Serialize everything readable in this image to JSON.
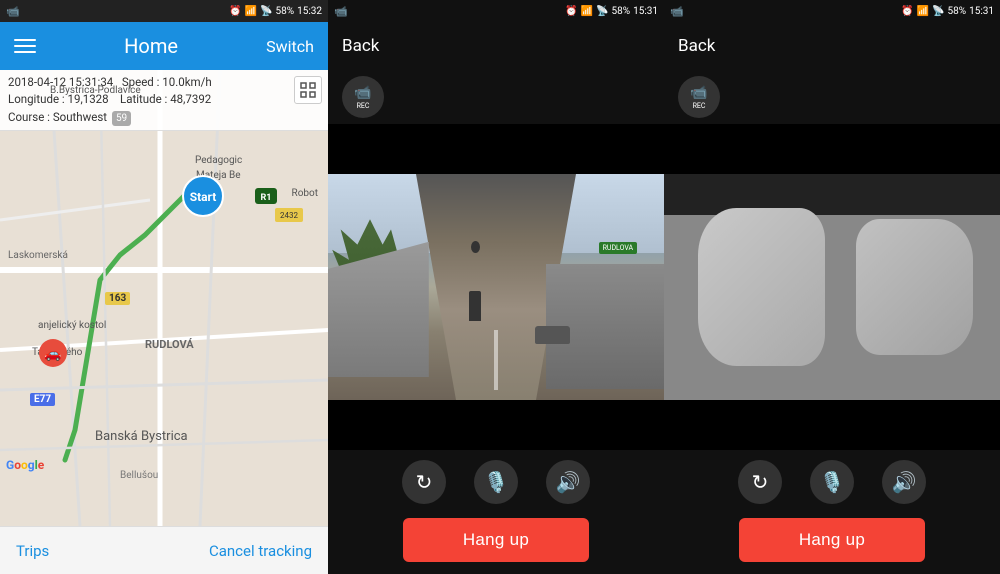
{
  "panel1": {
    "status_bar": {
      "left_icon": "📹",
      "time": "15:32",
      "battery": "58%"
    },
    "header": {
      "title": "Home",
      "switch_label": "Switch",
      "menu_icon": "menu"
    },
    "gps": {
      "datetime": "2018-04-12  15:31:34",
      "speed_label": "Speed :",
      "speed_value": "10.0km/h",
      "longitude_label": "Longitude :",
      "longitude_value": "19,1328",
      "latitude_label": "Latitude :",
      "latitude_value": "48,7392",
      "course_label": "Course :",
      "course_value": "Southwest",
      "speed_badge": "59"
    },
    "map": {
      "expand_icon": "⬜",
      "road_163": "163",
      "road_e77": "E77",
      "city_name": "Banská Bystrica",
      "city_name2": "RUDLOVÁ",
      "area1": "B.Bystrica-Podlavice",
      "area2": "Pedagogic",
      "area3": "Mateja Be",
      "area4": "Laskomerská",
      "area5": "anjelický kostol",
      "area6": "Tajovského",
      "area7": "Bellušou",
      "area8": "Robot",
      "start_label": "Start",
      "speed_limit": "59"
    },
    "bottom_bar": {
      "trips_label": "Trips",
      "cancel_label": "Cancel tracking"
    }
  },
  "panel2": {
    "status_bar": {
      "left_icon": "📹",
      "time": "15:31",
      "battery": "58%"
    },
    "back_label": "Back",
    "rec_label": "REC",
    "hangup_label": "Hang up",
    "controls": {
      "rotate": "↻",
      "mic": "🎤",
      "volume": "🔊"
    }
  },
  "panel3": {
    "status_bar": {
      "left_icon": "📹",
      "time": "15:31",
      "battery": "58%"
    },
    "back_label": "Back",
    "rec_label": "REC",
    "hangup_label": "Hang up",
    "controls": {
      "rotate": "↻",
      "mic": "🎤",
      "volume": "🔊"
    }
  },
  "colors": {
    "accent_blue": "#1a8fe0",
    "status_bar_bg": "#222",
    "video_bg": "#111",
    "hangup_red": "#f44336",
    "map_bg": "#e8e0d5",
    "header_bg": "#1a8fe0"
  }
}
